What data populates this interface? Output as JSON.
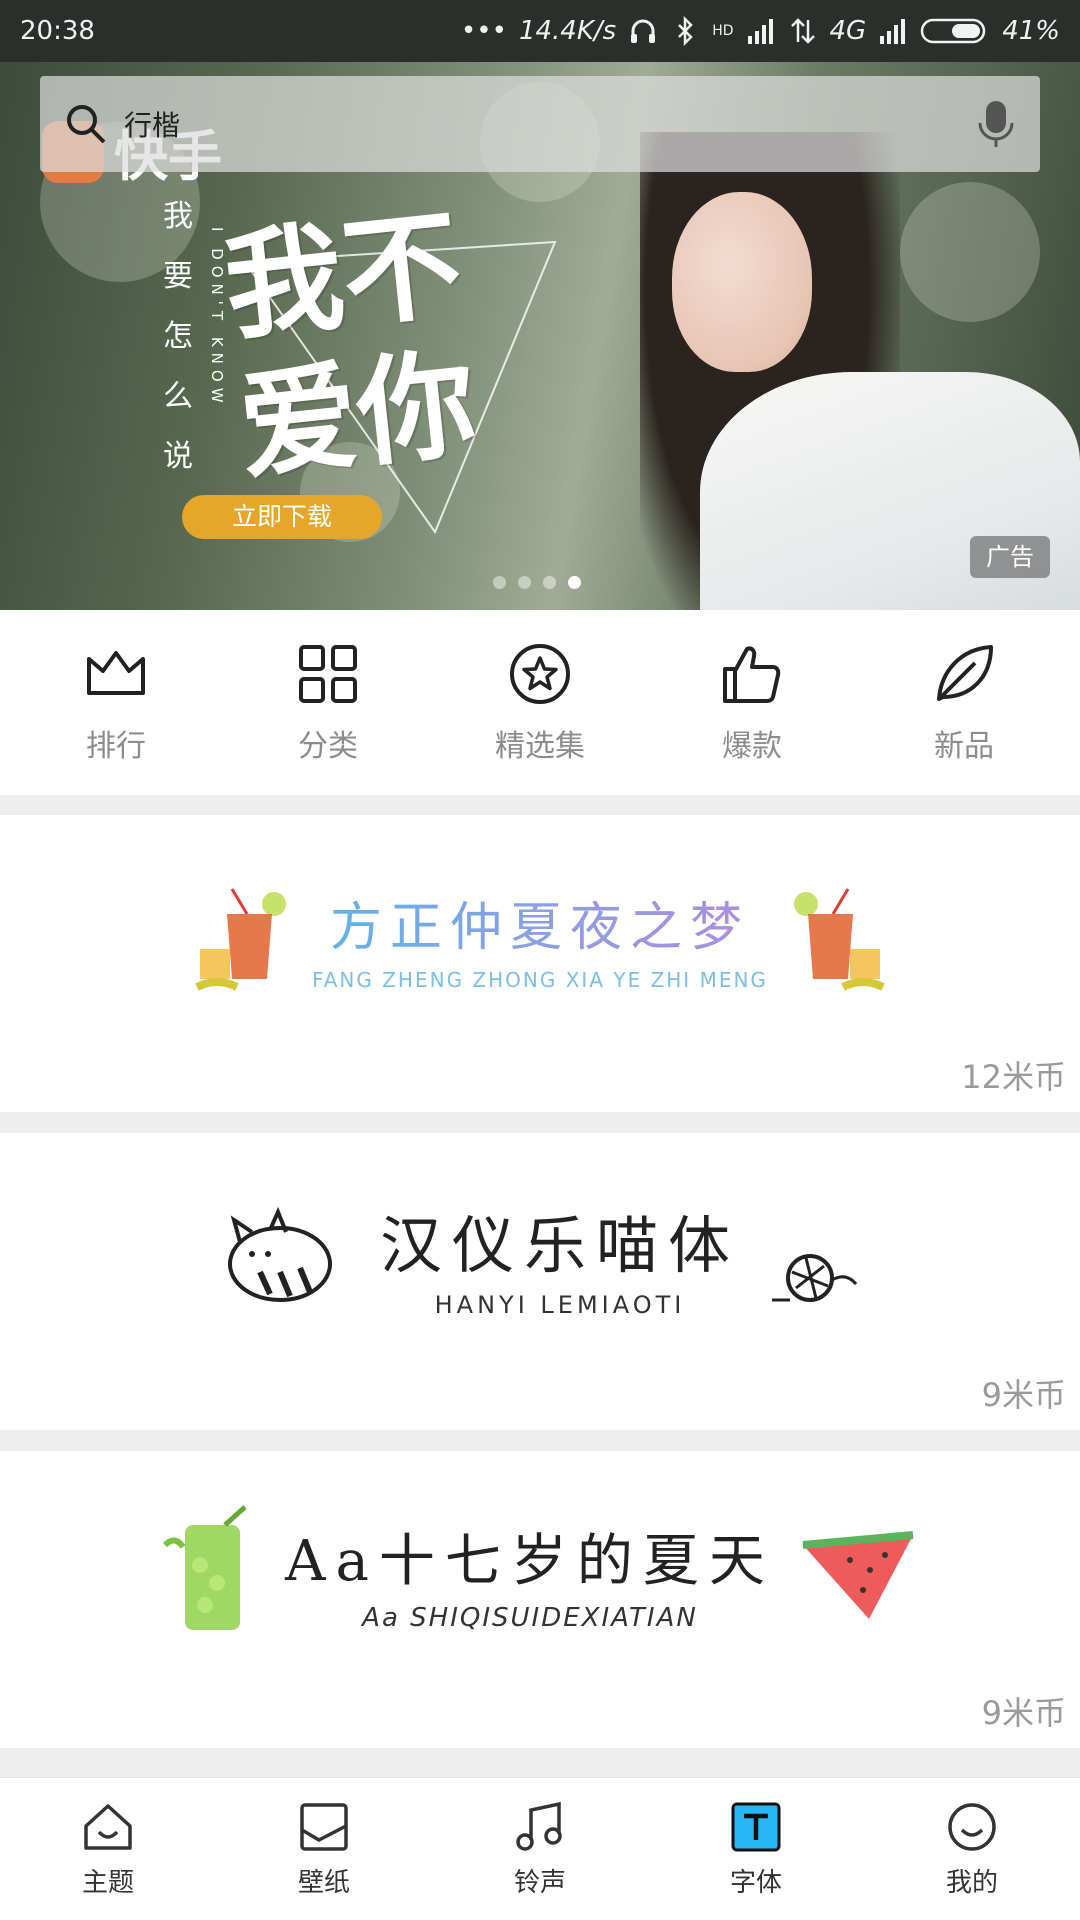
{
  "status_bar": {
    "time": "20:38",
    "dots": "•••",
    "net_speed": "14.4K/s",
    "hd_label": "HD",
    "network_type": "4G",
    "battery": "41%"
  },
  "search": {
    "query": "行楷"
  },
  "banner": {
    "logo_text": "快手",
    "vertical_text": [
      "我",
      "要",
      "怎",
      "么",
      "说"
    ],
    "vertical_en": "I DON'T KNOW",
    "title_line1": "我不",
    "title_line2": "爱你",
    "download_button": "立即下载",
    "ad_badge": "广告",
    "carousel_pages": 4,
    "carousel_active": 4
  },
  "categories": [
    {
      "label": "排行",
      "icon": "crown-icon"
    },
    {
      "label": "分类",
      "icon": "grid-icon"
    },
    {
      "label": "精选集",
      "icon": "star-circle-icon"
    },
    {
      "label": "爆款",
      "icon": "thumbs-up-icon"
    },
    {
      "label": "新品",
      "icon": "leaf-icon"
    }
  ],
  "fonts": [
    {
      "title": "方正仲夏夜之梦",
      "subtitle": "FANG ZHENG ZHONG XIA YE ZHI MENG",
      "price": "12米币"
    },
    {
      "title": "汉仪乐喵体",
      "subtitle": "HANYI LEMIAOTI",
      "price": "9米币"
    },
    {
      "title": "Aa十七岁的夏天",
      "subtitle": "Aa SHIQISUIDEXIATIAN",
      "price": "9米币"
    }
  ],
  "bottom_nav": [
    {
      "label": "主题",
      "icon": "home-icon"
    },
    {
      "label": "壁纸",
      "icon": "wallpaper-icon"
    },
    {
      "label": "铃声",
      "icon": "music-note-icon"
    },
    {
      "label": "字体",
      "icon": "font-t-icon",
      "active": true
    },
    {
      "label": "我的",
      "icon": "smiley-icon"
    }
  ],
  "colors": {
    "accent": "#29b6f6",
    "download_button": "#e6a62a",
    "price_text": "#9a9a9a"
  }
}
